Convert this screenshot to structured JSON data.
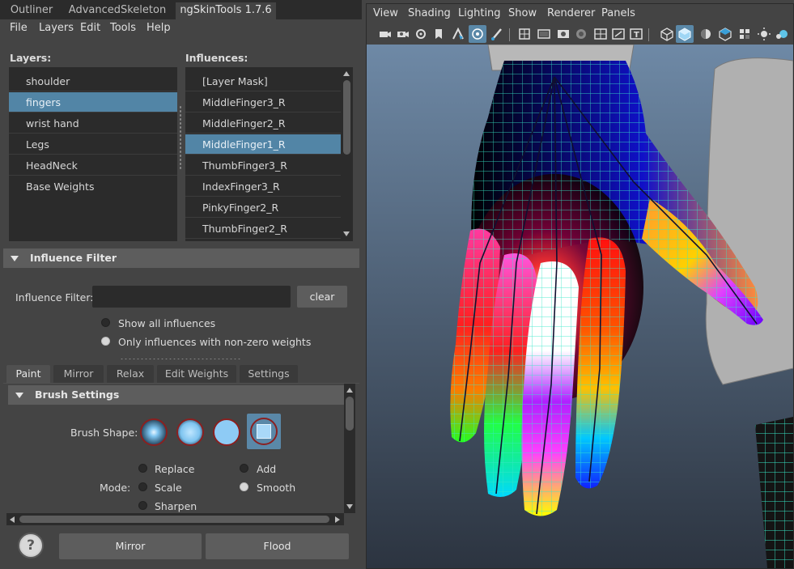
{
  "window_tabs": [
    "Outliner",
    "AdvancedSkeleton",
    "ngSkinTools 1.7.6"
  ],
  "menu": [
    "File",
    "Layers",
    "Edit",
    "Tools",
    "Help"
  ],
  "layers": {
    "header": "Layers:",
    "items": [
      "shoulder",
      "fingers",
      "wrist hand",
      "Legs",
      "HeadNeck",
      "Base Weights"
    ],
    "selected": "fingers"
  },
  "influences": {
    "header": "Influences:",
    "items": [
      "[Layer Mask]",
      "MiddleFinger3_R",
      "MiddleFinger2_R",
      "MiddleFinger1_R",
      "ThumbFinger3_R",
      "IndexFinger3_R",
      "PinkyFinger2_R",
      "ThumbFinger2_R"
    ],
    "selected": "MiddleFinger1_R"
  },
  "influence_filter": {
    "section_title": "Influence Filter",
    "label": "Influence Filter:",
    "value": "",
    "clear_label": "clear",
    "options": [
      "Show all influences",
      "Only influences with non-zero weights"
    ],
    "selected_option": "Only influences with non-zero weights"
  },
  "paint_tabs": [
    "Paint",
    "Mirror",
    "Relax",
    "Edit Weights",
    "Settings"
  ],
  "active_paint_tab": "Paint",
  "brush_settings": {
    "section_title": "Brush Settings",
    "shape_label": "Brush Shape:",
    "mode_label": "Mode:",
    "modes": [
      "Replace",
      "Add",
      "Scale",
      "Smooth",
      "Sharpen"
    ],
    "selected_mode": "Smooth"
  },
  "bottom_buttons": {
    "help_label": "?",
    "mirror_label": "Mirror",
    "flood_label": "Flood"
  },
  "viewport_menu": [
    "View",
    "Shading",
    "Lighting",
    "Show",
    "Renderer",
    "Panels"
  ],
  "colors": {
    "selection": "#5285a6",
    "panel_bg": "#444444",
    "list_bg": "#2b2b2b",
    "wireframe": "#38e8c8",
    "brush_ring": "#8a2020",
    "brush_fill": "#7ec4f0"
  }
}
